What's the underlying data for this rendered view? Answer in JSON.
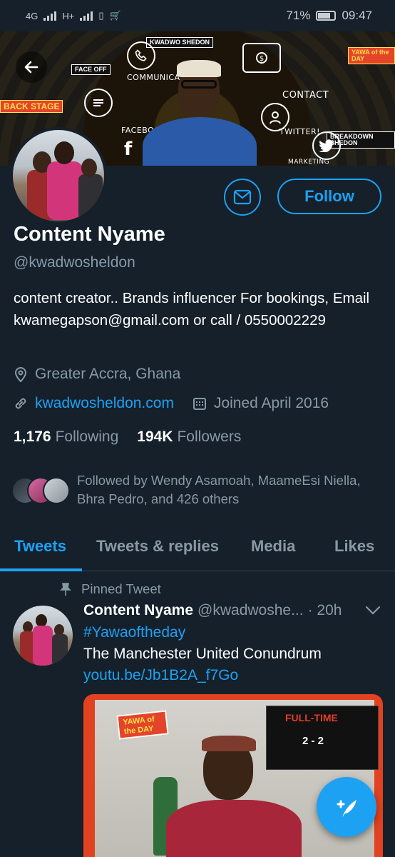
{
  "status_bar": {
    "network_1": "4G",
    "network_2": "H+",
    "battery": "71%",
    "time": "09:47"
  },
  "banner": {
    "words": [
      "COMMUNICATION",
      "CONTACT",
      "FACEBOOK",
      "TWITTER!",
      "MARKETING"
    ],
    "tags": [
      "KWADWO SHEDON",
      "FACE OFF",
      "YAWA of the DAY",
      "BREAKDOWN SHEDON",
      "BACK STAGE"
    ]
  },
  "profile": {
    "name": "Content Nyame",
    "handle": "@kwadwosheldon",
    "bio": "content creator.. Brands influencer For bookings, Email kwamegapson@gmail.com or call / 0550002229",
    "location": "Greater Accra, Ghana",
    "website": "kwadwosheldon.com",
    "joined": "Joined April 2016",
    "following_count": "1,176",
    "following_label": "Following",
    "followers_count": "194K",
    "followers_label": "Followers",
    "followed_by": "Followed by Wendy Asamoah, MaameEsi Niella, Bhra Pedro, and 426 others",
    "follow_label": "Follow"
  },
  "tabs": [
    {
      "label": "Tweets",
      "active": true
    },
    {
      "label": "Tweets & replies",
      "active": false
    },
    {
      "label": "Media",
      "active": false
    },
    {
      "label": "Likes",
      "active": false
    }
  ],
  "pinned_tweet": {
    "pinned_label": "Pinned Tweet",
    "author": "Content Nyame",
    "handle_trunc": "@kwadwoshe...",
    "time": "· 20h",
    "hashtag": "#Yawaoftheday",
    "text": "The Manchester United Conundrum",
    "link": "youtu.be/Jb1B2A_f7Go",
    "media": {
      "badge": "YAWA of the DAY",
      "fulltime": "FULL-TIME",
      "score": "2 - 2"
    }
  },
  "colors": {
    "background": "#15202b",
    "accent": "#1da1f2",
    "muted": "#8899a6"
  }
}
